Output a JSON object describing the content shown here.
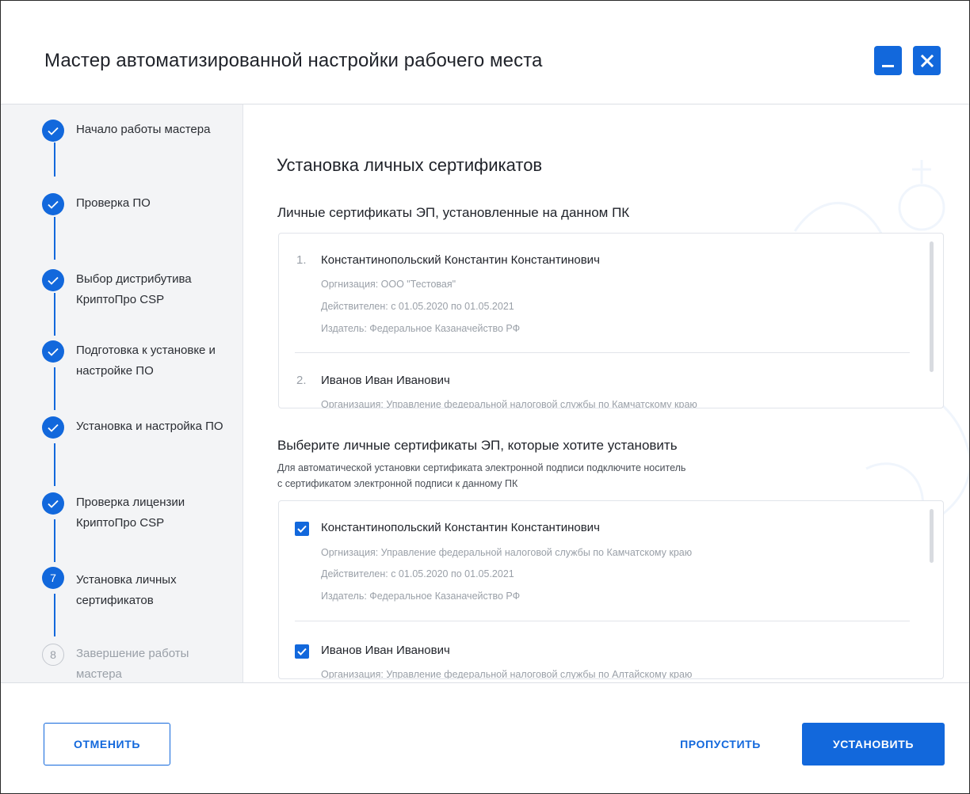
{
  "window": {
    "title": "Мастер автоматизированной настройки рабочего места",
    "accent_color": "#1268dc",
    "minimize_icon": "minimize-icon",
    "close_icon": "close-icon"
  },
  "steps": [
    {
      "number": "1",
      "label": "Начало работы мастера",
      "state": "done"
    },
    {
      "number": "2",
      "label": "Проверка ПО",
      "state": "done"
    },
    {
      "number": "3",
      "label": "Выбор дистрибутива КриптоПро CSP",
      "state": "done"
    },
    {
      "number": "4",
      "label": "Подготовка к установке и настройке ПО",
      "state": "done"
    },
    {
      "number": "5",
      "label": "Установка и настройка ПО",
      "state": "done"
    },
    {
      "number": "6",
      "label": "Проверка лицензии КриптоПро CSP",
      "state": "done"
    },
    {
      "number": "7",
      "label": "Установка личных сертификатов",
      "state": "current"
    },
    {
      "number": "8",
      "label": "Завершение работы мастера",
      "state": "todo"
    }
  ],
  "main": {
    "section_title": "Установка личных сертификатов",
    "installed_title": "Личные сертификаты ЭП, установленные на данном ПК",
    "installed": [
      {
        "num": "1.",
        "name": "Константинопольский Константин Константинович",
        "org": "Оргнизация: ООО \"Тестовая\"",
        "valid": "Действителен: с 01.05.2020 по 01.05.2021",
        "issuer": "Издатель: Федеральное Казаначейство РФ"
      },
      {
        "num": "2.",
        "name": "Иванов Иван Иванович",
        "org": "Организация: Управление федеральной налоговой службы по Камчатскому краю"
      }
    ],
    "select_title": "Выберите личные сертификаты ЭП, которые хотите установить",
    "select_hint_line1": "Для автоматической установки сертификата электронной подписи подключите носитель",
    "select_hint_line2": "с сертификатом электронной подписи к данному ПК",
    "selectable": [
      {
        "checked": true,
        "name": "Константинопольский Константин Константинович",
        "org": "Оргнизация: Управление федеральной налоговой службы по Камчатскому краю",
        "valid": "Действителен: с 01.05.2020 по 01.05.2021",
        "issuer": "Издатель: Федеральное Казаначейство РФ"
      },
      {
        "checked": true,
        "name": "Иванов Иван Иванович",
        "org": "Организация: Управление федеральной налоговой службы по Алтайскому краю"
      }
    ]
  },
  "footer": {
    "cancel_label": "ОТМЕНИТЬ",
    "skip_label": "ПРОПУСТИТЬ",
    "install_label": "УСТАНОВИТЬ"
  }
}
